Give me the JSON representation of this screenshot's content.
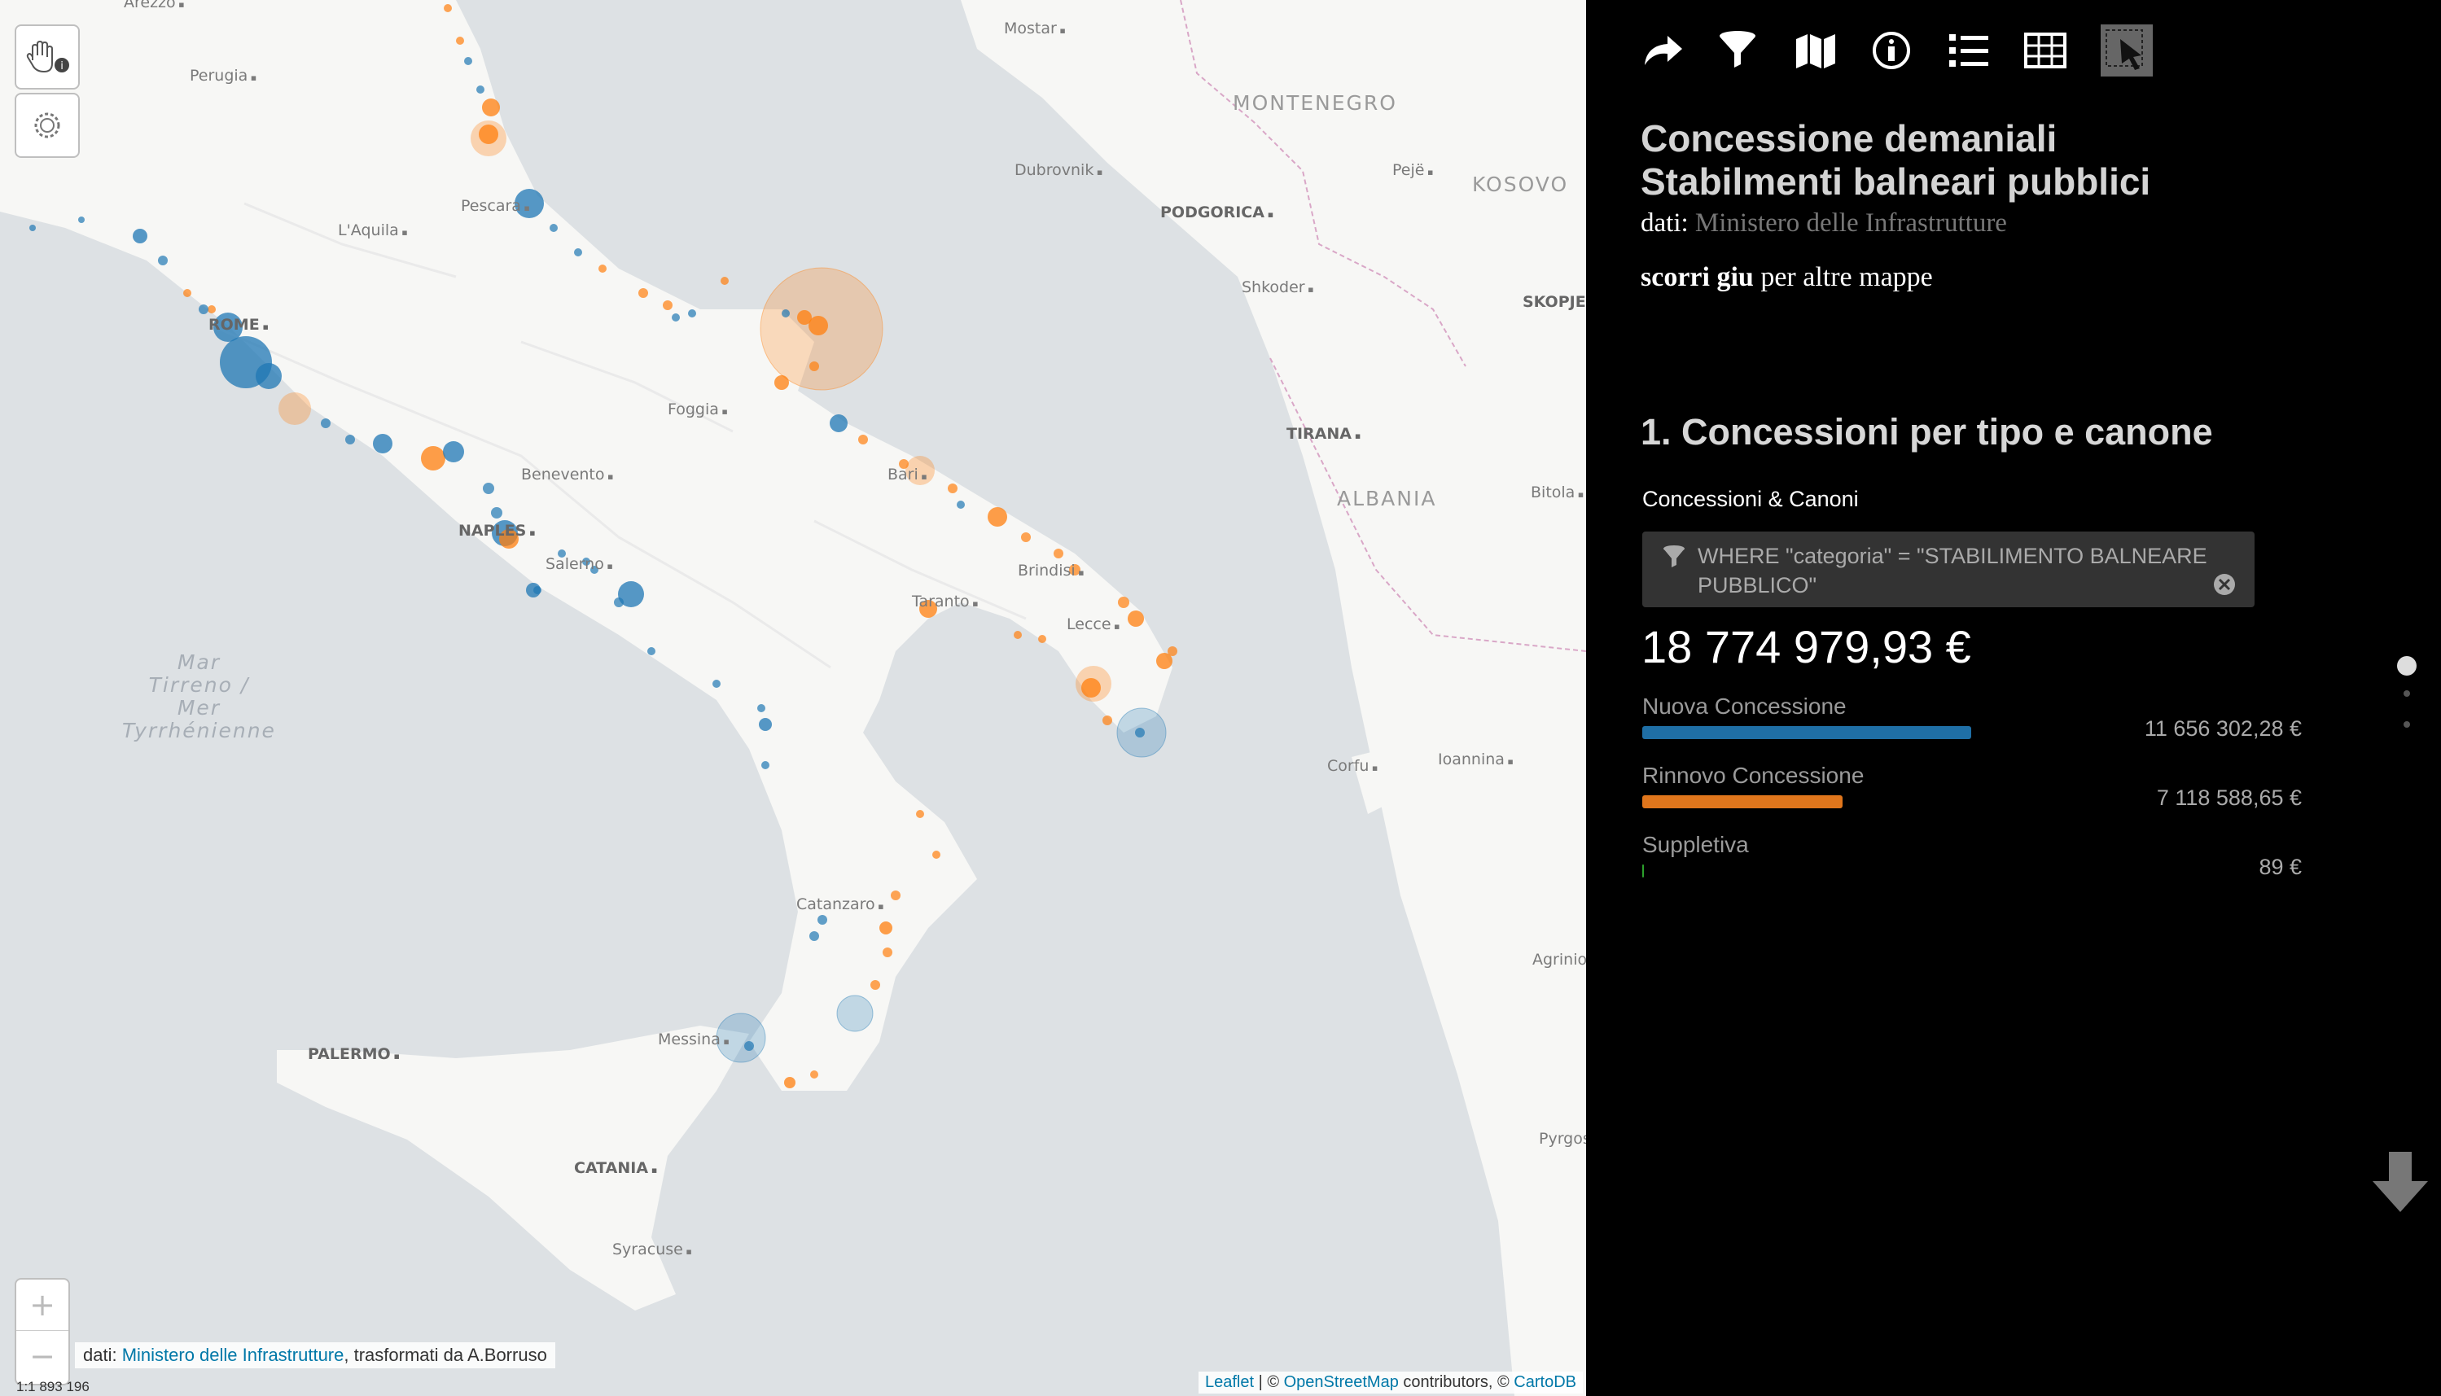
{
  "map": {
    "places": [
      {
        "name": "Arezzo",
        "cls": "city"
      },
      {
        "name": "Mostar",
        "cls": "city"
      },
      {
        "name": "Perugia",
        "cls": "city"
      },
      {
        "name": "MONTENEGRO",
        "cls": "country"
      },
      {
        "name": "Dubrovnik",
        "cls": "city"
      },
      {
        "name": "Pejë",
        "cls": "city"
      },
      {
        "name": "KOSOVO",
        "cls": "country"
      },
      {
        "name": "Pescara",
        "cls": "city"
      },
      {
        "name": "L'Aquila",
        "cls": "city"
      },
      {
        "name": "PODGORICA",
        "cls": "city bold"
      },
      {
        "name": "Shkoder",
        "cls": "city"
      },
      {
        "name": "SKOPJE",
        "cls": "city bold"
      },
      {
        "name": "ROME",
        "cls": "city bold"
      },
      {
        "name": "Foggia",
        "cls": "city"
      },
      {
        "name": "TIRANA",
        "cls": "city bold"
      },
      {
        "name": "Benevento",
        "cls": "city"
      },
      {
        "name": "Bari",
        "cls": "city"
      },
      {
        "name": "ALBANIA",
        "cls": "country"
      },
      {
        "name": "Bitola",
        "cls": "city"
      },
      {
        "name": "NAPLES",
        "cls": "city bold"
      },
      {
        "name": "Salerno",
        "cls": "city"
      },
      {
        "name": "Brindisi",
        "cls": "city"
      },
      {
        "name": "Taranto",
        "cls": "city"
      },
      {
        "name": "Lecce",
        "cls": "city"
      },
      {
        "name": "Mar\nTirreno /\nMer\nTyrrhénienne",
        "cls": "sea"
      },
      {
        "name": "Ioannina",
        "cls": "city"
      },
      {
        "name": "Corfu",
        "cls": "city"
      },
      {
        "name": "Catanzaro",
        "cls": "city"
      },
      {
        "name": "Agrinio",
        "cls": "city"
      },
      {
        "name": "PALERMO",
        "cls": "city bold"
      },
      {
        "name": "Messina",
        "cls": "city"
      },
      {
        "name": "Pyrgos",
        "cls": "city"
      },
      {
        "name": "CATANIA",
        "cls": "city bold"
      },
      {
        "name": "Syracuse",
        "cls": "city"
      }
    ],
    "zoom_in": "+",
    "zoom_out": "−",
    "attribution_prefix": "dati: ",
    "attribution_link": "Ministero delle Infrastrutture",
    "attribution_suffix": ", trasformati da A.Borruso",
    "leaflet": "Leaflet",
    "osm_prefix": " | © ",
    "osm": "OpenStreetMap",
    "osm_suffix": " contributors, © ",
    "carto": "CartoDB",
    "scale": "1:1 893 196"
  },
  "panel": {
    "toolbar": [
      "share-icon",
      "filter-icon",
      "map-icon",
      "info-icon",
      "list-icon",
      "table-icon",
      "select-icon"
    ],
    "title_line1": "Concessione demaniali",
    "title_line2": "Stabilmenti balneari pubblici",
    "source_label": "dati: ",
    "source_value": "Ministero delle Infrastrutture",
    "scroll_bold": "scorri giu",
    "scroll_rest": " per altre mappe",
    "section_title": "1. Concessioni per tipo e canone",
    "widget_title": "Concessioni & Canoni",
    "filter_text": "WHERE \"categoria\" = \"STABILIMENTO BALNEARE PUBBLICO\"",
    "total": "18 774 979,93 €",
    "categories": [
      {
        "label": "Nuova Concessione",
        "value": "11 656 302,28 €",
        "color": "#1f6fa6",
        "share": 0.6208
      },
      {
        "label": "Rinnovo Concessione",
        "value": "7 118 588,65 €",
        "color": "#e0761c",
        "share": 0.3791
      },
      {
        "label": "Suppletiva",
        "value": "89 €",
        "color": "#2ca02c",
        "share": 4.7e-06
      }
    ]
  },
  "colors": {
    "blue": "#1f77b4",
    "orange": "#ff7f0e",
    "panel_bg": "#000000"
  }
}
